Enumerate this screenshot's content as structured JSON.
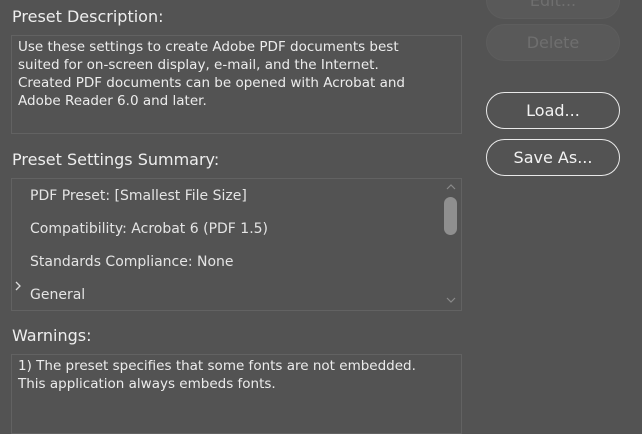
{
  "buttons": {
    "edit_label": "Edit...",
    "delete_label": "Delete",
    "load_label": "Load...",
    "save_as_label": "Save As..."
  },
  "preset_description": {
    "label": "Preset Description:",
    "lines": [
      "Use these settings to create Adobe PDF documents best",
      "suited for on-screen display, e-mail, and the Internet.",
      "Created PDF documents can be opened with Acrobat and",
      "Adobe Reader 6.0 and later."
    ]
  },
  "summary": {
    "label": "Preset Settings Summary:",
    "items": [
      "PDF Preset: [Smallest File Size]",
      "Compatibility: Acrobat 6 (PDF 1.5)",
      "Standards Compliance: None",
      "General"
    ]
  },
  "warnings": {
    "label": "Warnings:",
    "lines": [
      "1) The preset specifies that some fonts are not embedded.",
      "This application always embeds fonts."
    ]
  },
  "icons": {
    "expand": "chevron-right-icon",
    "scroll_up": "chevron-up-icon",
    "scroll_down": "chevron-down-icon"
  },
  "colors": {
    "background": "#535353",
    "text": "#e6e6e6",
    "border": "#626262",
    "button_border": "#e9e9e9",
    "disabled_text": "#6f6f6f"
  }
}
